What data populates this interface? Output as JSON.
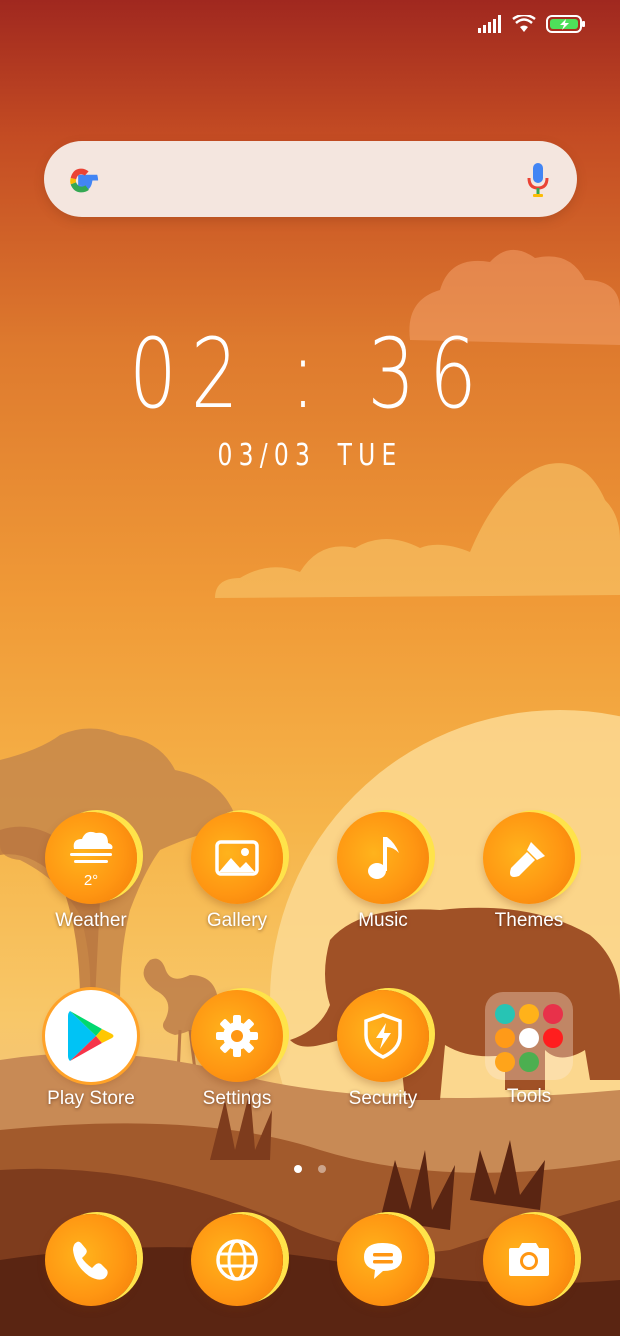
{
  "status_bar": {
    "icons": [
      "signal-icon",
      "wifi-icon",
      "battery-charging-icon"
    ]
  },
  "search": {
    "logo": "google-g-icon",
    "mic": "mic-icon"
  },
  "clock": {
    "time": "02 : 36",
    "date": "03/03",
    "day": "TUE"
  },
  "apps": {
    "weather": {
      "label": "Weather",
      "temp": "2°",
      "icon": "cloud-sun-icon"
    },
    "gallery": {
      "label": "Gallery",
      "icon": "picture-icon"
    },
    "music": {
      "label": "Music",
      "icon": "music-note-icon"
    },
    "themes": {
      "label": "Themes",
      "icon": "paint-brush-icon"
    },
    "playstore": {
      "label": "Play Store",
      "icon": "play-store-icon"
    },
    "settings": {
      "label": "Settings",
      "icon": "gear-icon"
    },
    "security": {
      "label": "Security",
      "icon": "shield-bolt-icon"
    },
    "tools": {
      "label": "Tools",
      "icon": "folder-icon"
    }
  },
  "dock": [
    "phone-icon",
    "browser-globe-icon",
    "messages-icon",
    "camera-icon"
  ],
  "pages": {
    "count": 2,
    "active": 1
  },
  "colors": {
    "accent": "#ff9612",
    "highlight": "#ffe34a",
    "sky_top": "#a0281f",
    "silhouette": "#a05126"
  }
}
